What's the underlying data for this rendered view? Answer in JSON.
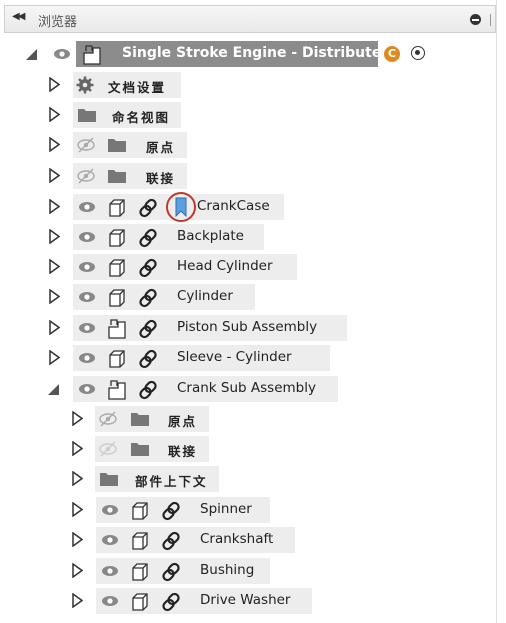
{
  "panel": {
    "title": "浏览器",
    "collapse_icon": "double-left-arrow-icon",
    "pin_icon": "minus-circle-icon"
  },
  "root": {
    "label": "Single Stroke Engine - Distributed",
    "badge": "C",
    "state": "expanded"
  },
  "folders": {
    "doc_settings": "文档设置",
    "named_views": "命名视图",
    "origin": "原点",
    "joints": "联接"
  },
  "components": [
    {
      "label": "CrankCase",
      "icon": "body-icon",
      "bookmark": true
    },
    {
      "label": "Backplate",
      "icon": "body-icon"
    },
    {
      "label": "Head Cylinder",
      "icon": "body-icon"
    },
    {
      "label": "Cylinder",
      "icon": "body-icon"
    },
    {
      "label": "Piston Sub Assembly",
      "icon": "assembly-icon"
    },
    {
      "label": "Sleeve - Cylinder",
      "icon": "body-icon"
    },
    {
      "label": "Crank Sub Assembly",
      "icon": "assembly-icon",
      "state": "expanded"
    }
  ],
  "sub": {
    "origin": "原点",
    "joints": "联接",
    "context": "部件上下文",
    "components": [
      {
        "label": "Spinner"
      },
      {
        "label": "Crankshaft"
      },
      {
        "label": "Bushing"
      },
      {
        "label": "Drive Washer"
      }
    ]
  },
  "colors": {
    "root_bg": "#8c8c8c",
    "label_bg": "#ededed",
    "badge": "#e08a1e",
    "bookmark": "#5aa0e0",
    "highlight": "#c0392b"
  }
}
